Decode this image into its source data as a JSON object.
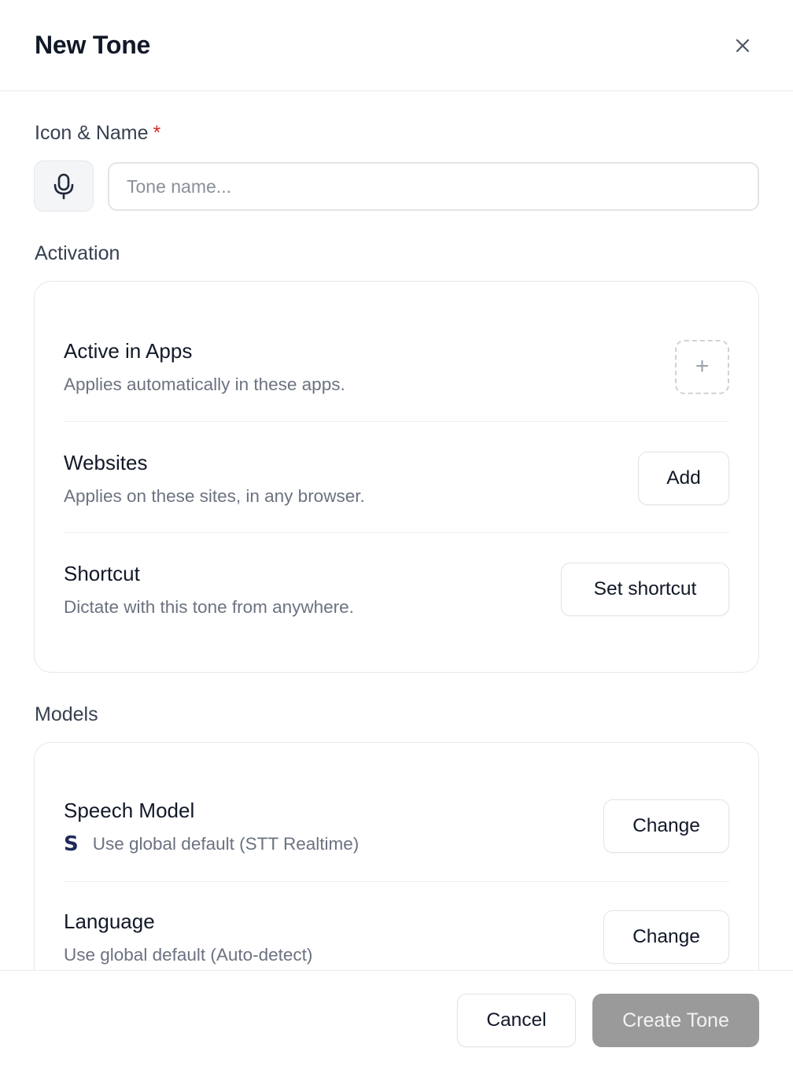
{
  "dialog": {
    "title": "New Tone"
  },
  "identity": {
    "label": "Icon & Name",
    "required_mark": "*",
    "icon": "microphone-icon",
    "name_placeholder": "Tone name...",
    "name_value": ""
  },
  "activation": {
    "label": "Activation",
    "rows": [
      {
        "title": "Active in Apps",
        "description": "Applies automatically in these apps.",
        "action": "+"
      },
      {
        "title": "Websites",
        "description": "Applies on these sites, in any browser.",
        "action": "Add"
      },
      {
        "title": "Shortcut",
        "description": "Dictate with this tone from anywhere.",
        "action": "Set shortcut"
      }
    ]
  },
  "models": {
    "label": "Models",
    "rows": [
      {
        "title": "Speech Model",
        "logo": "S",
        "description": "Use global default (STT Realtime)",
        "action": "Change"
      },
      {
        "title": "Language",
        "description": "Use global default (Auto-detect)",
        "action": "Change"
      }
    ]
  },
  "footer": {
    "cancel_label": "Cancel",
    "create_label": "Create Tone"
  },
  "colors": {
    "required": "#dc2626",
    "create_disabled_bg": "#9a9a9a",
    "logo": "#1e2a5a"
  }
}
